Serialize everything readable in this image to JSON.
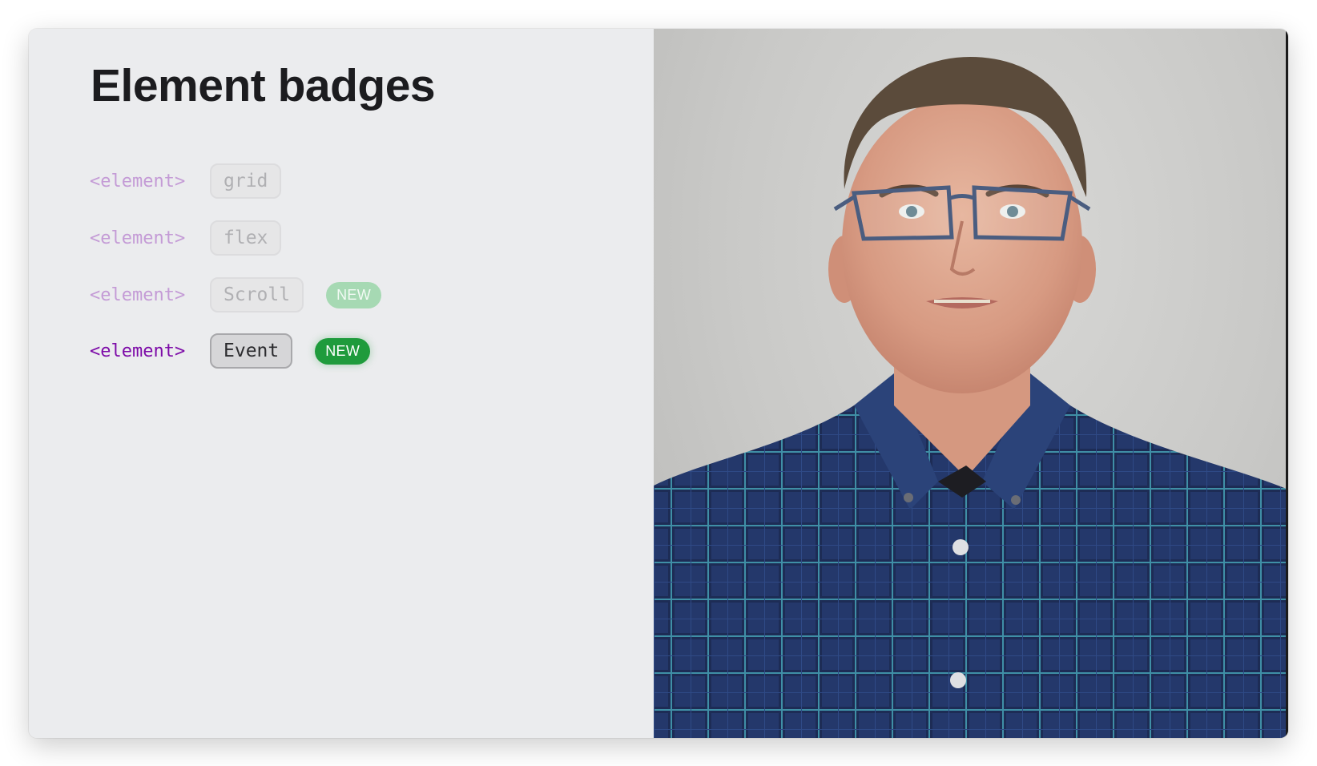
{
  "slide": {
    "title": "Element badges",
    "rows": [
      {
        "tag": "<element>",
        "badge": "grid",
        "new_label": null,
        "state": "faded"
      },
      {
        "tag": "<element>",
        "badge": "flex",
        "new_label": null,
        "state": "faded"
      },
      {
        "tag": "<element>",
        "badge": "Scroll",
        "new_label": "NEW",
        "state": "faded"
      },
      {
        "tag": "<element>",
        "badge": "Event",
        "new_label": "NEW",
        "state": "active"
      }
    ]
  },
  "colors": {
    "tag_faded": "#c49bd6",
    "tag_active": "#7d0ba8",
    "new_faded": "#a6d9b3",
    "new_active": "#1f9b3c",
    "background": "#ebecee"
  },
  "photo": {
    "subject": "presenter in blue plaid shirt with glasses"
  }
}
